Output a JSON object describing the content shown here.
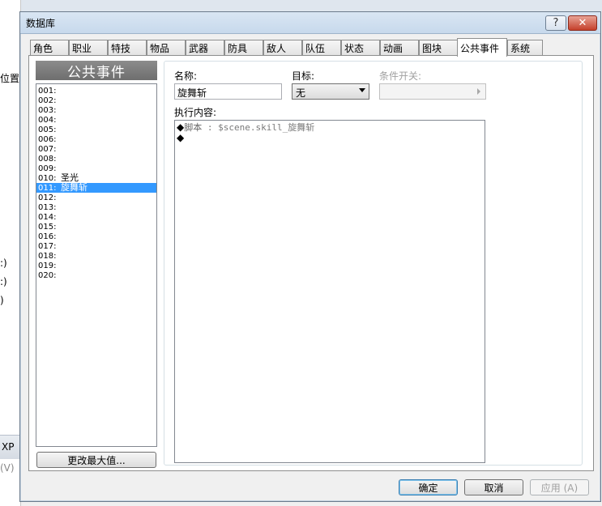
{
  "background": {
    "left_texts": [
      "位置",
      ":)",
      ":)",
      ")",
      "XP",
      "(V)"
    ]
  },
  "dialog": {
    "title": "数据库",
    "help_glyph": "?",
    "close_glyph": "✕"
  },
  "tabs": [
    {
      "label": "角色"
    },
    {
      "label": "职业"
    },
    {
      "label": "特技"
    },
    {
      "label": "物品"
    },
    {
      "label": "武器"
    },
    {
      "label": "防具"
    },
    {
      "label": "敌人"
    },
    {
      "label": "队伍"
    },
    {
      "label": "状态"
    },
    {
      "label": "动画"
    },
    {
      "label": "图块"
    },
    {
      "label": "公共事件",
      "active": true
    },
    {
      "label": "系统"
    }
  ],
  "list": {
    "header": "公共事件",
    "items": [
      {
        "num": "001:",
        "name": ""
      },
      {
        "num": "002:",
        "name": ""
      },
      {
        "num": "003:",
        "name": ""
      },
      {
        "num": "004:",
        "name": ""
      },
      {
        "num": "005:",
        "name": ""
      },
      {
        "num": "006:",
        "name": ""
      },
      {
        "num": "007:",
        "name": ""
      },
      {
        "num": "008:",
        "name": ""
      },
      {
        "num": "009:",
        "name": ""
      },
      {
        "num": "010:",
        "name": "圣光"
      },
      {
        "num": "011:",
        "name": "旋舞斩",
        "selected": true
      },
      {
        "num": "012:",
        "name": ""
      },
      {
        "num": "013:",
        "name": ""
      },
      {
        "num": "014:",
        "name": ""
      },
      {
        "num": "015:",
        "name": ""
      },
      {
        "num": "016:",
        "name": ""
      },
      {
        "num": "017:",
        "name": ""
      },
      {
        "num": "018:",
        "name": ""
      },
      {
        "num": "019:",
        "name": ""
      },
      {
        "num": "020:",
        "name": ""
      }
    ],
    "change_max_button": "更改最大值..."
  },
  "form": {
    "name_label": "名称:",
    "name_value": "旋舞斩",
    "target_label": "目标:",
    "target_value": "无",
    "switch_label": "条件开关:",
    "content_label": "执行内容:",
    "commands": [
      {
        "marker": "◆",
        "keyword": "脚本",
        "sep": " : ",
        "value": "$scene.skill_旋舞斩"
      },
      {
        "marker": "◆",
        "keyword": "",
        "sep": "",
        "value": ""
      }
    ]
  },
  "buttons": {
    "ok": "确定",
    "cancel": "取消",
    "apply": "应用 (A)"
  }
}
